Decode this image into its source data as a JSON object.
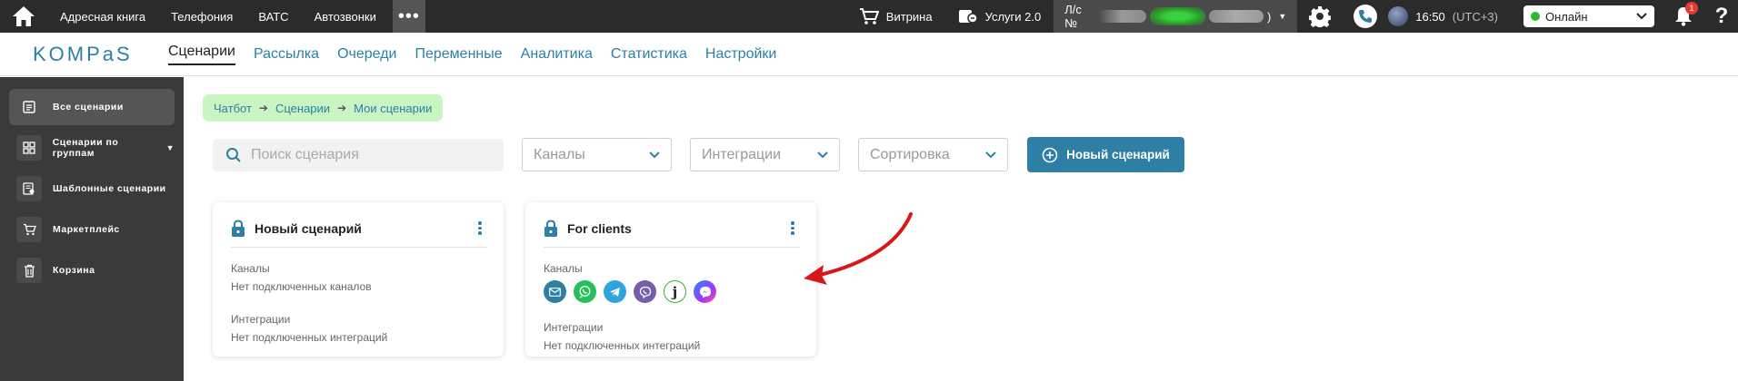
{
  "topbar": {
    "nav": [
      "Адресная книга",
      "Телефония",
      "ВАТС",
      "Автозвонки"
    ],
    "more_label": "•••",
    "showcase_label": "Витрина",
    "services_label": "Услуги 2.0",
    "account_prefix": "Л/с №",
    "account_suffix": ")",
    "time": "16:50",
    "timezone": "(UTC+3)",
    "status": "Онлайн",
    "notifications_count": "1",
    "help_label": "?"
  },
  "navbar": {
    "logo": "KOMPaS",
    "tabs": [
      "Сценарии",
      "Рассылка",
      "Очереди",
      "Переменные",
      "Аналитика",
      "Статистика",
      "Настройки"
    ],
    "active_tab": "Сценарии"
  },
  "sidebar": {
    "items": [
      {
        "label": "Все сценарии",
        "icon": "list-icon",
        "active": true
      },
      {
        "label": "Сценарии по группам",
        "icon": "grid-icon",
        "active": false
      },
      {
        "label": "Шаблонные сценарии",
        "icon": "template-icon",
        "active": false
      },
      {
        "label": "Маркетплейс",
        "icon": "cart-icon",
        "active": false
      },
      {
        "label": "Корзина",
        "icon": "trash-icon",
        "active": false
      }
    ]
  },
  "breadcrumb": [
    "Чатбот",
    "Сценарии",
    "Мои сценарии"
  ],
  "filters": {
    "search_placeholder": "Поиск сценария",
    "channels": "Каналы",
    "integrations": "Интеграции",
    "sort": "Сортировка",
    "new_button": "Новый сценарий"
  },
  "cards": [
    {
      "title": "Новый сценарий",
      "channels_label": "Каналы",
      "channels_value": "Нет подключенных каналов",
      "integrations_label": "Интеграции",
      "integrations_value": "Нет подключенных интеграций"
    },
    {
      "title": "For clients",
      "channels_label": "Каналы",
      "channels": [
        "email",
        "whatsapp",
        "telegram",
        "viber",
        "jivo",
        "messenger"
      ],
      "integrations_label": "Интеграции",
      "integrations_value": "Нет подключенных интеграций"
    }
  ],
  "colors": {
    "accent": "#2d7fa6",
    "topbar": "#2b2b2b",
    "sidebar": "#3a3a3a",
    "breadcrumb_bg": "#c8f5c1",
    "annotation_arrow": "#e02020"
  }
}
